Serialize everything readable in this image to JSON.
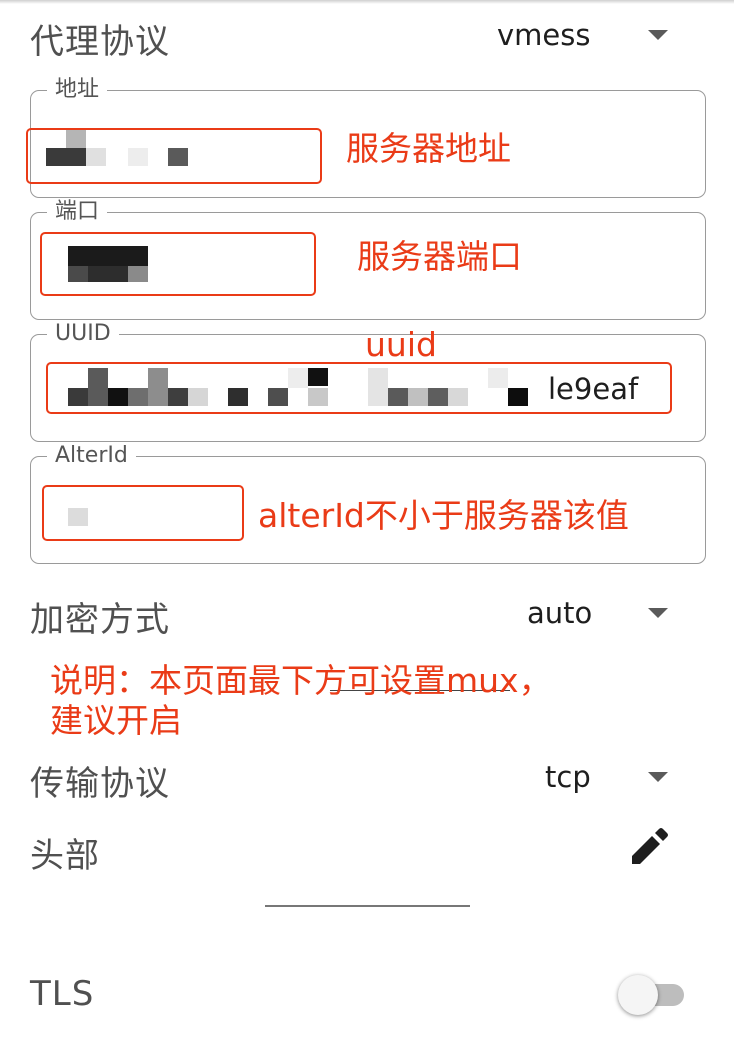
{
  "protocol": {
    "label": "代理协议",
    "value": "vmess"
  },
  "fields": {
    "address": {
      "label": "地址"
    },
    "port": {
      "label": "端口"
    },
    "uuid": {
      "label": "UUID",
      "visible_suffix": "le9eaf"
    },
    "alter_id": {
      "label": "AlterId"
    }
  },
  "encryption": {
    "label": "加密方式",
    "value": "auto"
  },
  "transport": {
    "label": "传输协议",
    "value": "tcp"
  },
  "header": {
    "label": "头部"
  },
  "tls": {
    "label": "TLS",
    "enabled": false
  },
  "annotations": {
    "address": "服务器地址",
    "port": "服务器端口",
    "uuid": "uuid",
    "alter_id": "alterId不小于服务器该值",
    "note_line1": "说明：本页面最下方可设置mux，",
    "note_line2": "建议开启"
  },
  "colors": {
    "annotation": "#ea3b17",
    "label": "#505050",
    "outline": "#9a9a9a"
  },
  "icons": {
    "dropdown": "caret-down-icon",
    "edit": "pencil-icon"
  }
}
